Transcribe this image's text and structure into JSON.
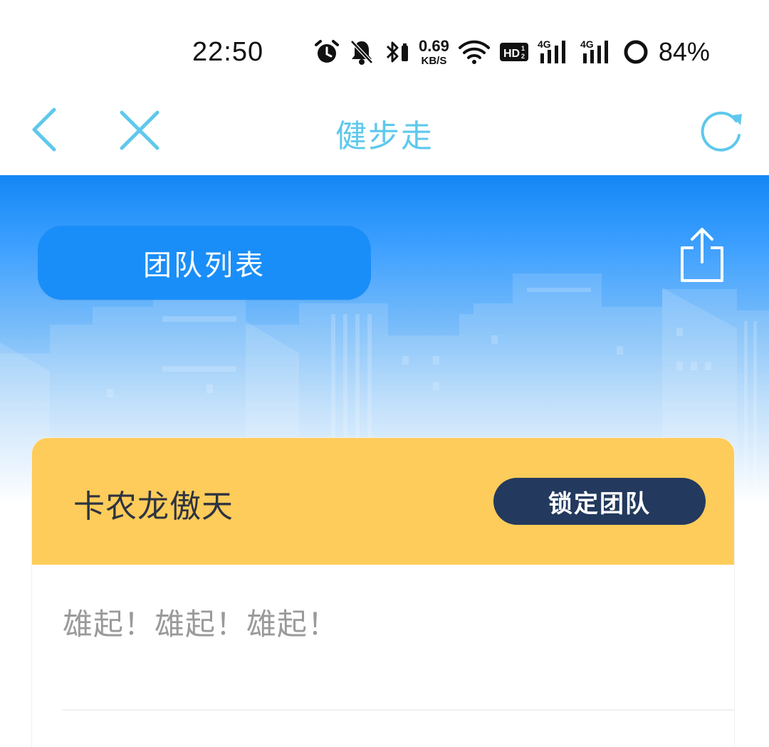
{
  "status_bar": {
    "time": "22:50",
    "net_speed_value": "0.69",
    "net_speed_unit": "KB/S",
    "battery": "84%",
    "icons": [
      "alarm-icon",
      "mute-bell-icon",
      "bluetooth-icon",
      "wifi-icon",
      "hd-icon",
      "signal-4g-icon",
      "signal-4g-icon",
      "battery-ring-icon"
    ]
  },
  "nav": {
    "title": "健步走",
    "back_icon": "chevron-left-icon",
    "close_icon": "close-icon",
    "refresh_icon": "refresh-icon",
    "accent_color": "#5ec8ec"
  },
  "hero": {
    "team_list_label": "团队列表",
    "share_icon": "share-icon"
  },
  "team_card": {
    "name": "卡农龙傲天",
    "lock_button_label": "锁定团队",
    "slogan": "雄起！雄起！雄起！",
    "header_color": "#fecc5a",
    "lock_button_color": "#23395d"
  }
}
